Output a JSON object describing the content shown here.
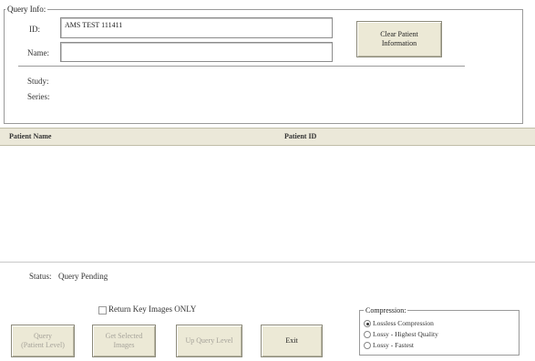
{
  "query_info": {
    "legend": "Query Info:",
    "id_label": "ID:",
    "id_value": "AMS TEST 111411",
    "name_label": "Name:",
    "name_value": "",
    "study_label": "Study:",
    "series_label": "Series:",
    "clear_button_line1": "Clear Patient",
    "clear_button_line2": "Information"
  },
  "table": {
    "columns": [
      "Patient Name",
      "Patient ID"
    ],
    "rows": []
  },
  "status": {
    "label": "Status:",
    "value": "Query Pending"
  },
  "options": {
    "return_key_images_label": "Return Key Images ONLY",
    "return_key_images_checked": false
  },
  "buttons": {
    "query_line1": "Query",
    "query_line2": "(Patient Level)",
    "get_selected_line1": "Get Selected",
    "get_selected_line2": "Images",
    "up_query_level": "Up Query Level",
    "exit": "Exit"
  },
  "compression": {
    "legend": "Compression:",
    "options": [
      "Lossless Compression",
      "Lossy - Highest Quality",
      "Lossy - Fastest"
    ],
    "selected": "Lossless Compression"
  }
}
